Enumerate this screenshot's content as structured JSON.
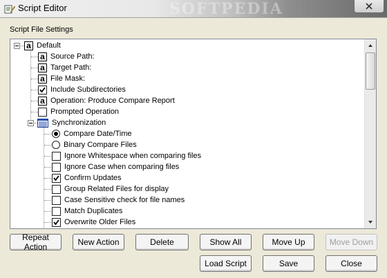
{
  "window": {
    "title": "Script Editor",
    "watermark": "SOFTPEDIA"
  },
  "group": {
    "label": "Script File Settings"
  },
  "tree": {
    "root": {
      "label": "Default",
      "icon": "attribute-a-icon",
      "expanded": true
    },
    "items": [
      {
        "label": "Source Path:",
        "icon": "attribute-a-icon"
      },
      {
        "label": "Target Path:",
        "icon": "attribute-a-icon"
      },
      {
        "label": "File Mask:",
        "icon": "attribute-a-icon"
      },
      {
        "label": "Include Subdirectories",
        "icon": "checkbox",
        "checked": true
      },
      {
        "label": "Operation: Produce Compare Report",
        "icon": "attribute-a-icon"
      },
      {
        "label": "Prompted Operation",
        "icon": "checkbox",
        "checked": false
      }
    ],
    "sync": {
      "label": "Synchronization",
      "icon": "list-icon",
      "expanded": true,
      "items": [
        {
          "label": "Compare Date/Time",
          "icon": "radio",
          "checked": true
        },
        {
          "label": "Binary Compare Files",
          "icon": "radio",
          "checked": false
        },
        {
          "label": "Ignore Whitespace when comparing files",
          "icon": "checkbox",
          "checked": false
        },
        {
          "label": "Ignore Case when comparing files",
          "icon": "checkbox",
          "checked": false
        },
        {
          "label": "Confirm Updates",
          "icon": "checkbox",
          "checked": true
        },
        {
          "label": "Group Related Files for display",
          "icon": "checkbox",
          "checked": false
        },
        {
          "label": "Case Sensitive check for file names",
          "icon": "checkbox",
          "checked": false
        },
        {
          "label": "Match Duplicates",
          "icon": "checkbox",
          "checked": false
        },
        {
          "label": "Overwrite Older Files",
          "icon": "checkbox",
          "checked": true
        }
      ]
    }
  },
  "buttons": {
    "repeat_action": "Repeat Action",
    "new_action": "New Action",
    "delete": "Delete",
    "show_all": "Show All",
    "move_up": "Move Up",
    "move_down": "Move Down",
    "load_script": "Load Script",
    "save": "Save",
    "close": "Close"
  }
}
